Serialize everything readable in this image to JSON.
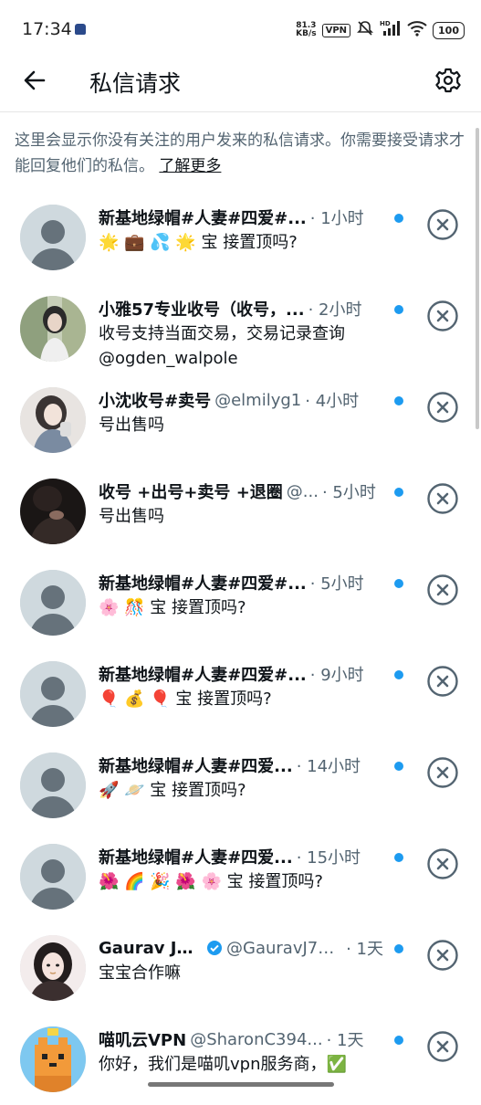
{
  "status_bar": {
    "time": "17:34",
    "net_speed_value": "81.3",
    "net_speed_unit": "KB/s",
    "vpn": "VPN",
    "hd": "HD",
    "battery": "100"
  },
  "header": {
    "title": "私信请求"
  },
  "notice": {
    "text": "这里会显示你没有关注的用户发来的私信请求。你需要接受请求才能回复他们的私信。",
    "link": "了解更多"
  },
  "messages": [
    {
      "name": "新基地绿帽#人妻#四爱#...",
      "handle": "",
      "time": "· 1小时",
      "body": "🌟 💼 💦 🌟 宝  接置顶吗?",
      "avatar": "default",
      "verified": false
    },
    {
      "name": "小雅57专业收号（收号，...",
      "handle": "",
      "time": "· 2小时",
      "body": "收号支持当面交易，交易记录查询\n@ogden_walpole",
      "avatar": "photo-girl-plants",
      "verified": false
    },
    {
      "name": "小沈收号#卖号",
      "handle": "@elmilyg1",
      "time": "· 4小时",
      "body": "号出售吗",
      "avatar": "photo-girl-white",
      "verified": false
    },
    {
      "name": "收号 +出号+卖号 +退圈",
      "handle": "@...",
      "time": "· 5小时",
      "body": "号出售吗",
      "avatar": "photo-dark",
      "verified": false
    },
    {
      "name": "新基地绿帽#人妻#四爱#...",
      "handle": "",
      "time": "· 5小时",
      "body": "🌸 🎊 宝  接置顶吗?",
      "avatar": "default",
      "verified": false
    },
    {
      "name": "新基地绿帽#人妻#四爱#...",
      "handle": "",
      "time": "· 9小时",
      "body": "🎈 💰 🎈 宝  接置顶吗?",
      "avatar": "default",
      "verified": false
    },
    {
      "name": "新基地绿帽#人妻#四爱...",
      "handle": "",
      "time": "· 14小时",
      "body": "🚀 🪐 宝  接置顶吗?",
      "avatar": "default",
      "verified": false
    },
    {
      "name": "新基地绿帽#人妻#四爱...",
      "handle": "",
      "time": "· 15小时",
      "body": "🌺 🌈 🎉 🌺 🌸 宝  接置顶吗?",
      "avatar": "default",
      "verified": false
    },
    {
      "name": "Gaurav Jain",
      "handle": "@GauravJ70...",
      "time": "· 1天",
      "body": "宝宝合作嘛",
      "avatar": "photo-girl-selfie",
      "verified": true
    },
    {
      "name": "喵叽云VPN",
      "handle": "@SharonC394...",
      "time": "· 1天",
      "body": "你好，我们是喵叽vpn服务商，✅",
      "avatar": "cartoon-cat",
      "verified": false
    }
  ],
  "icons": {
    "back": "arrow-left-icon",
    "settings": "gear-icon",
    "dismiss": "close-circle-icon",
    "verified": "verified-badge-icon"
  },
  "colors": {
    "accent": "#1d9bf0",
    "secondary_text": "#536471",
    "primary_text": "#0f1419",
    "avatar_bg": "#cfd9de",
    "avatar_fg": "#66727b"
  }
}
